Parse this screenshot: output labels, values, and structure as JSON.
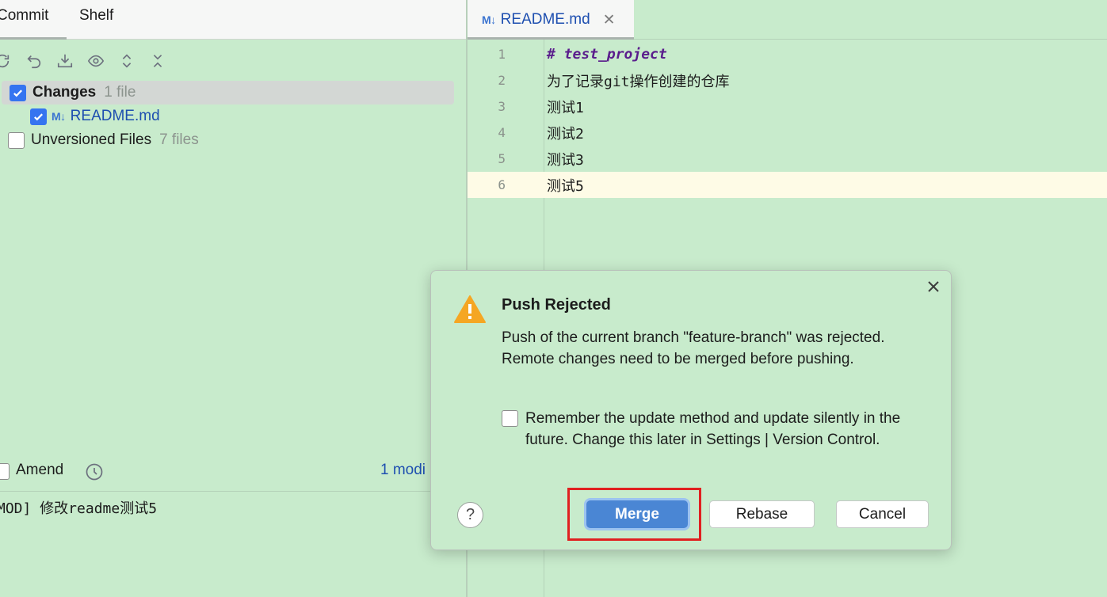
{
  "left_panel": {
    "tabs": [
      {
        "label": "Commit"
      },
      {
        "label": "Shelf"
      }
    ],
    "toolbar_icons": [
      "refresh-icon",
      "rollback-icon",
      "update-icon",
      "eye-icon",
      "expand-icon",
      "collapse-icon"
    ],
    "tree": {
      "changes": {
        "label": "Changes",
        "count": "1 file",
        "checked": true
      },
      "file": {
        "icon": "M↓",
        "label": "README.md",
        "checked": true
      },
      "unversioned": {
        "label": "Unversioned Files",
        "count": "7 files",
        "checked": false
      }
    },
    "amend": {
      "label": "Amend",
      "checked": false
    },
    "modified_link": "1 modi",
    "commit_message": "MOD] 修改readme测试5"
  },
  "editor": {
    "tab": {
      "icon": "M↓",
      "title": "README.md",
      "close": "✕"
    },
    "lines": [
      {
        "num": "1",
        "text": "# test_project"
      },
      {
        "num": "2",
        "text": "为了记录git操作创建的仓库"
      },
      {
        "num": "3",
        "text": "测试1"
      },
      {
        "num": "4",
        "text": "测试2"
      },
      {
        "num": "5",
        "text": "测试3"
      },
      {
        "num": "6",
        "text": "测试5"
      }
    ]
  },
  "dialog": {
    "title": "Push Rejected",
    "message": "Push of the current branch \"feature-branch\" was rejected. Remote changes need to be merged before pushing.",
    "remember_text": "Remember the update method and update silently in the future. Change this later in Settings | Version Control.",
    "remember_checked": false,
    "help": "?",
    "buttons": {
      "merge": "Merge",
      "rebase": "Rebase",
      "cancel": "Cancel"
    }
  },
  "colors": {
    "background": "#c8ebcc",
    "accent": "#3574f0",
    "primary_button": "#4a86d4",
    "link": "#1e4fb0",
    "warning": "#f5a623",
    "highlight_box": "#e02020"
  }
}
